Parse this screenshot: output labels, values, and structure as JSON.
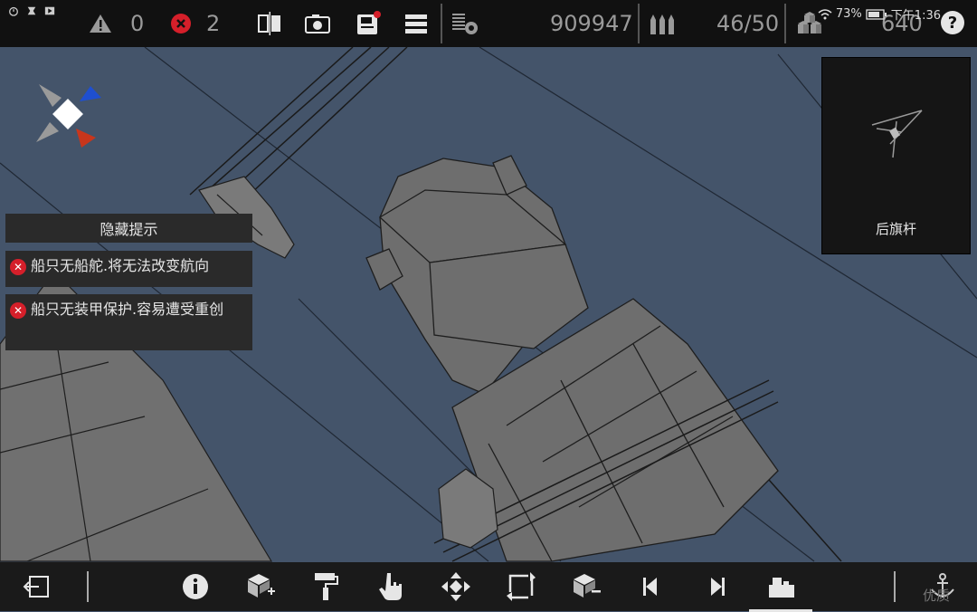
{
  "topbar": {
    "warning_count": "0",
    "error_count": "2",
    "credits": "909947",
    "ammo_capacity": "46/50",
    "blocks": "640"
  },
  "system": {
    "battery": "73%",
    "time": "下午1:36"
  },
  "hints": {
    "hide_label": "隐藏提示",
    "warnings": [
      "船只无船舵.将无法改变航向",
      "船只无装甲保护.容易遭受重创"
    ]
  },
  "minimap": {
    "label": "后旗杆"
  },
  "bottombar": {
    "watermark": "优质"
  },
  "colors": {
    "background": "#44546a",
    "error_red": "#d51f2a",
    "compass_blue": "#1f4fd0",
    "compass_red": "#c8361c"
  }
}
